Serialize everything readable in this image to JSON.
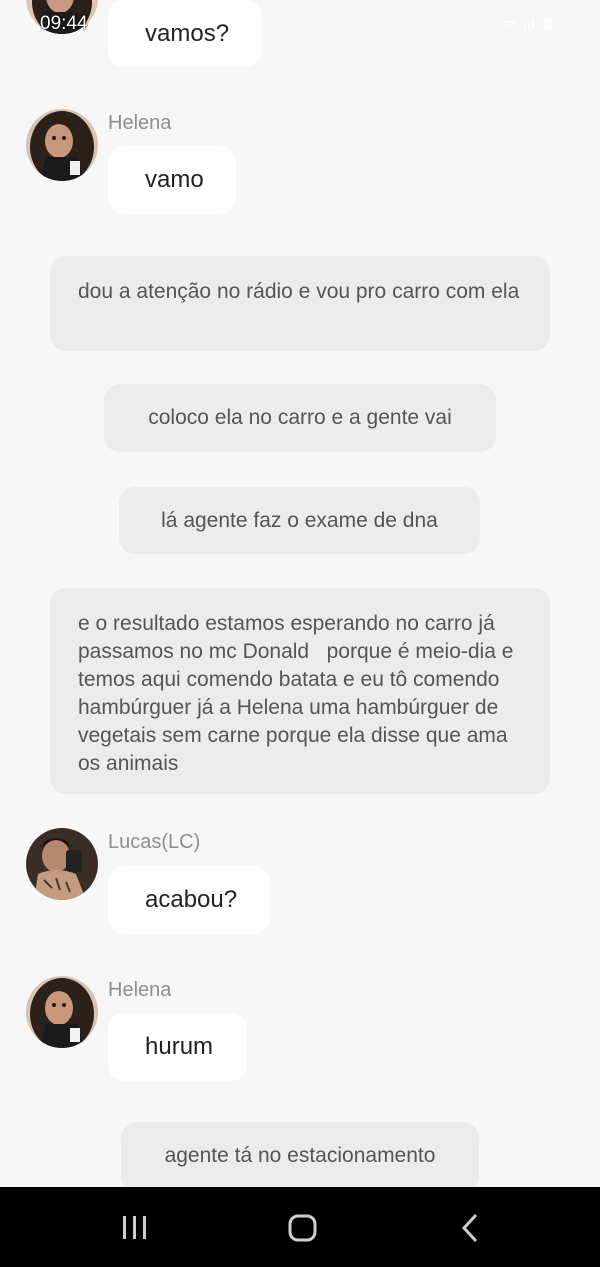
{
  "status_bar": {
    "time": "09:44",
    "icons": "wifi-icon signal-icon battery-icon"
  },
  "messages": [
    {
      "type": "incoming",
      "sender": "",
      "text": "vamos?",
      "avatar": "helena-avatar"
    },
    {
      "type": "incoming",
      "sender": "Helena",
      "text": "vamo",
      "avatar": "helena-avatar"
    },
    {
      "type": "narration",
      "text": "dou a atenção no rádio e vou pro carro com ela"
    },
    {
      "type": "narration",
      "text": "coloco ela no carro e a gente vai"
    },
    {
      "type": "narration",
      "text": "lá agente faz o exame de dna"
    },
    {
      "type": "narration",
      "text": "e o resultado estamos esperando no carro já passamos no mc Donald   porque é meio-dia e temos aqui comendo batata e eu tô comendo hambúrguer já a Helena uma hambúrguer de vegetais sem carne porque ela disse que ama os animais"
    },
    {
      "type": "incoming",
      "sender": "Lucas(LC)",
      "text": "acabou?",
      "avatar": "lucas-avatar"
    },
    {
      "type": "incoming",
      "sender": "Helena",
      "text": "hurum",
      "avatar": "helena-avatar"
    },
    {
      "type": "narration",
      "text": "agente tá no estacionamento"
    }
  ],
  "navbar": {
    "recent_icon": "recent-apps-icon",
    "home_icon": "home-icon",
    "back_icon": "back-icon"
  },
  "colors": {
    "background": "#f7f7f7",
    "bubble_incoming": "#ffffff",
    "bubble_narration": "#ececec",
    "sender_name": "#8e8e8e",
    "navbar": "#000000"
  }
}
